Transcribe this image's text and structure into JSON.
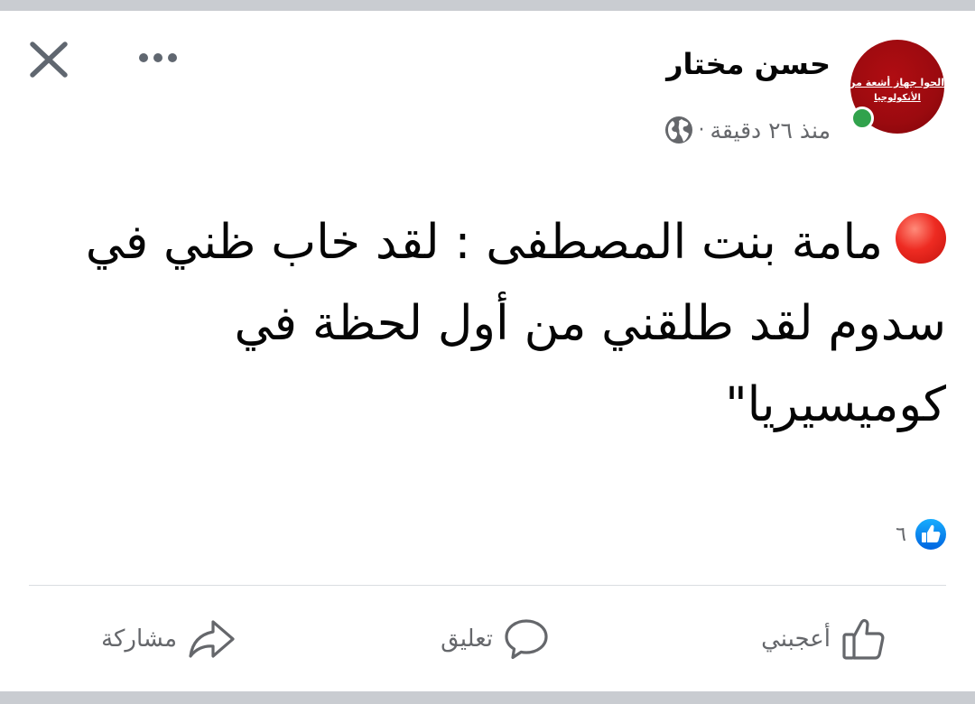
{
  "post": {
    "author_name": "حسن مختار",
    "avatar_text_line1": "الحوا جهاز أشعة من",
    "avatar_text_line2": "الأنكولوجيا",
    "time": "منذ ٢٦ دقيقة",
    "separator": "·",
    "privacy_icon": "globe-icon",
    "status_indicator": "online",
    "text": "مامة بنت المصطفى : لقد خاب ظني في سدوم لقد طلقني من أول لحظة في كوميسيريا\"",
    "leading_emoji": "red-circle-icon"
  },
  "header": {
    "close_icon": "close-icon",
    "more_icon": "more-options-icon"
  },
  "reactions": {
    "icon": "like-badge-icon",
    "count": "٦"
  },
  "actions": {
    "like_label": "أعجبني",
    "comment_label": "تعليق",
    "share_label": "مشاركة"
  },
  "colors": {
    "primary_text": "#050505",
    "secondary_text": "#65676b",
    "like_blue": "#1877f2",
    "online_green": "#31a24c",
    "avatar_red": "#9b0a0f"
  }
}
